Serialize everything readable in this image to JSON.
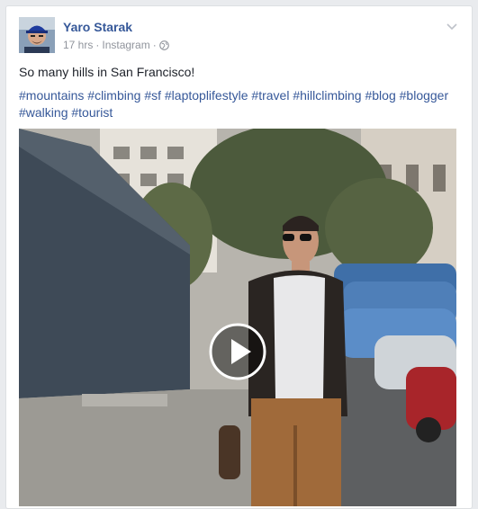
{
  "post": {
    "author": "Yaro Starak",
    "time": "17 hrs",
    "separator": "·",
    "source": "Instagram",
    "separator2": "·",
    "message": "So many hills in San Francisco!",
    "hashtags": [
      "#mountains",
      "#climbing",
      "#sf",
      "#laptoplifestyle",
      "#travel",
      "#hillclimbing",
      "#blog",
      "#blogger",
      "#walking",
      "#tourist"
    ]
  },
  "icons": {
    "privacy": "globe-icon",
    "menu": "chevron-down-icon",
    "play": "play-icon"
  },
  "colors": {
    "link": "#365899",
    "meta": "#90949c",
    "text": "#1d2129",
    "background": "#e9ebee"
  }
}
